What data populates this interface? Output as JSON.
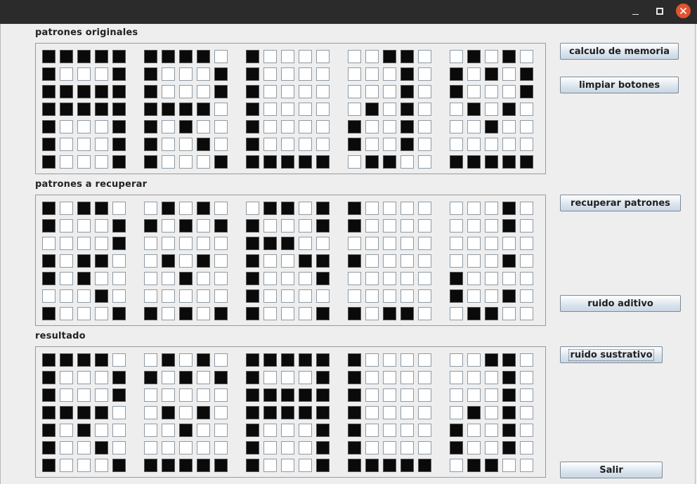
{
  "window": {
    "controls": [
      "minimize-icon",
      "maximize-icon",
      "close-icon"
    ]
  },
  "sections": [
    {
      "label": "patrones originales",
      "patterns": [
        [
          "11111",
          "10001",
          "11111",
          "11111",
          "10001",
          "10001",
          "10001"
        ],
        [
          "11110",
          "10001",
          "10001",
          "11110",
          "10100",
          "10010",
          "10001"
        ],
        [
          "10000",
          "10000",
          "10000",
          "10000",
          "10000",
          "10000",
          "11111"
        ],
        [
          "00110",
          "00010",
          "00010",
          "01010",
          "10010",
          "10010",
          "01100"
        ],
        [
          "01010",
          "10101",
          "10001",
          "01010",
          "00100",
          "00000",
          "11111"
        ]
      ]
    },
    {
      "label": "patrones a recuperar",
      "patterns": [
        [
          "10110",
          "10001",
          "00001",
          "10110",
          "10100",
          "00010",
          "10001"
        ],
        [
          "01010",
          "10101",
          "00000",
          "01010",
          "00100",
          "00000",
          "10101"
        ],
        [
          "01101",
          "10001",
          "11100",
          "10011",
          "10001",
          "10000",
          "10001"
        ],
        [
          "10000",
          "10000",
          "00000",
          "10000",
          "00000",
          "00000",
          "10110"
        ],
        [
          "00010",
          "00010",
          "00000",
          "00010",
          "10000",
          "10010",
          "01100"
        ]
      ]
    },
    {
      "label": "resultado",
      "patterns": [
        [
          "11110",
          "10001",
          "10001",
          "11110",
          "10100",
          "10010",
          "10001"
        ],
        [
          "01010",
          "10101",
          "00000",
          "01010",
          "00100",
          "00000",
          "11111"
        ],
        [
          "11111",
          "10001",
          "11111",
          "11111",
          "10001",
          "10001",
          "10001"
        ],
        [
          "10000",
          "10000",
          "10000",
          "10000",
          "10000",
          "10000",
          "11111"
        ],
        [
          "00110",
          "00010",
          "00010",
          "01010",
          "10010",
          "10010",
          "01100"
        ]
      ]
    }
  ],
  "buttons": {
    "calculo": "calculo de memoria",
    "limpiar": "limpiar botones",
    "recuperar": "recuperar patrones",
    "aditivo": "ruido aditivo",
    "sustrativo": "ruido sustrativo",
    "salir": "Salir"
  },
  "colors": {
    "cell_on": "#0a0a0a",
    "cell_off": "#ffffff",
    "close_button": "#e2532f",
    "titlebar": "#2b2b2b"
  }
}
